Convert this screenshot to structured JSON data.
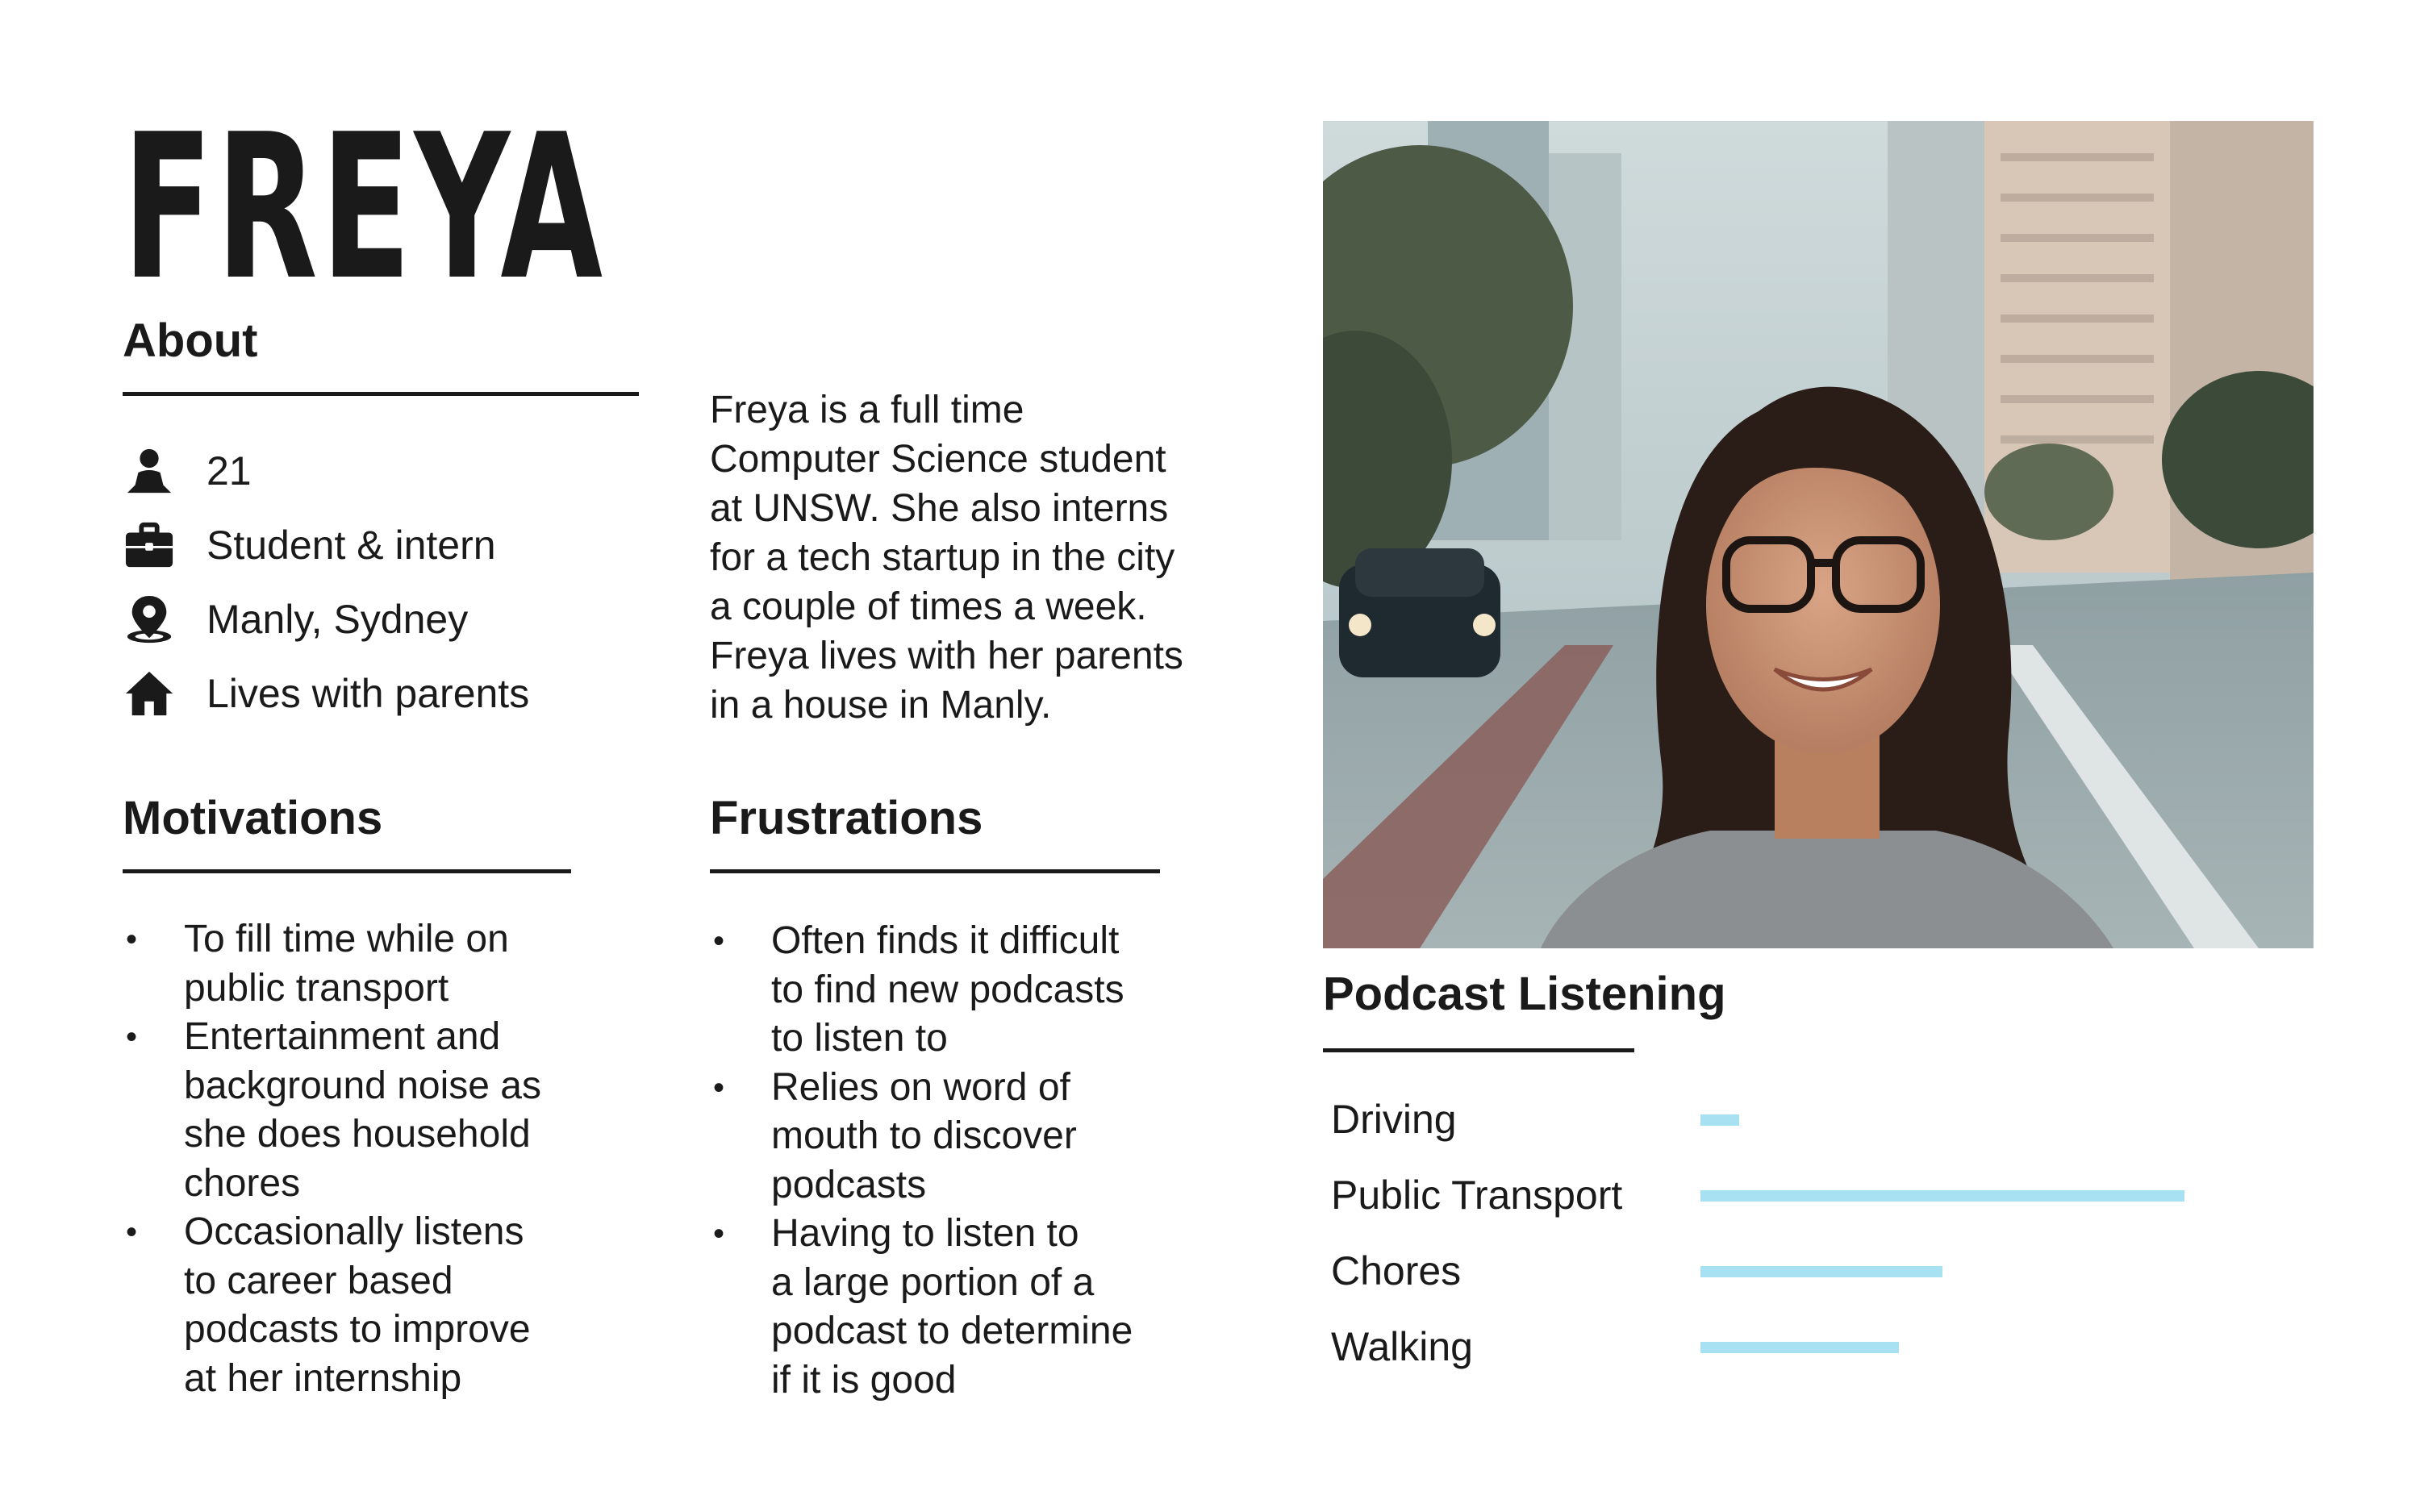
{
  "persona": {
    "name": "FREYA"
  },
  "about": {
    "heading": "About",
    "items": [
      {
        "icon": "person-icon",
        "text": "21"
      },
      {
        "icon": "briefcase-icon",
        "text": "Student & intern"
      },
      {
        "icon": "location-pin-icon",
        "text": "Manly, Sydney"
      },
      {
        "icon": "home-icon",
        "text": "Lives with parents"
      }
    ],
    "description": [
      "Freya is a full time",
      "Computer Science student",
      "at UNSW. She also interns",
      "for a tech startup in the city",
      "a couple of times a week.",
      "Freya lives with her parents",
      "in a house in Manly."
    ]
  },
  "motivations": {
    "heading": "Motivations",
    "items": [
      [
        "To fill time while on",
        "public transport"
      ],
      [
        "Entertainment and",
        "background noise as",
        "she does household",
        "chores"
      ],
      [
        "Occasionally listens",
        "to career based",
        "podcasts to improve",
        "at her internship"
      ]
    ]
  },
  "frustrations": {
    "heading": "Frustrations",
    "items": [
      [
        "Often finds it difficult",
        "to find new podcasts",
        "to listen to"
      ],
      [
        "Relies on word of",
        "mouth to discover",
        "podcasts"
      ],
      [
        "Having to listen to",
        "a large portion of a",
        "podcast to determine",
        "if it is good"
      ]
    ]
  },
  "podcast_listening": {
    "heading": "Podcast Listening",
    "bar_color": "#a8e2f2",
    "rows": [
      {
        "label": "Driving",
        "level": 0.08
      },
      {
        "label": "Public Transport",
        "level": 1.0
      },
      {
        "label": "Chores",
        "level": 0.5
      },
      {
        "label": "Walking",
        "level": 0.41
      }
    ]
  },
  "photo": {
    "icon": "portrait-photo"
  }
}
